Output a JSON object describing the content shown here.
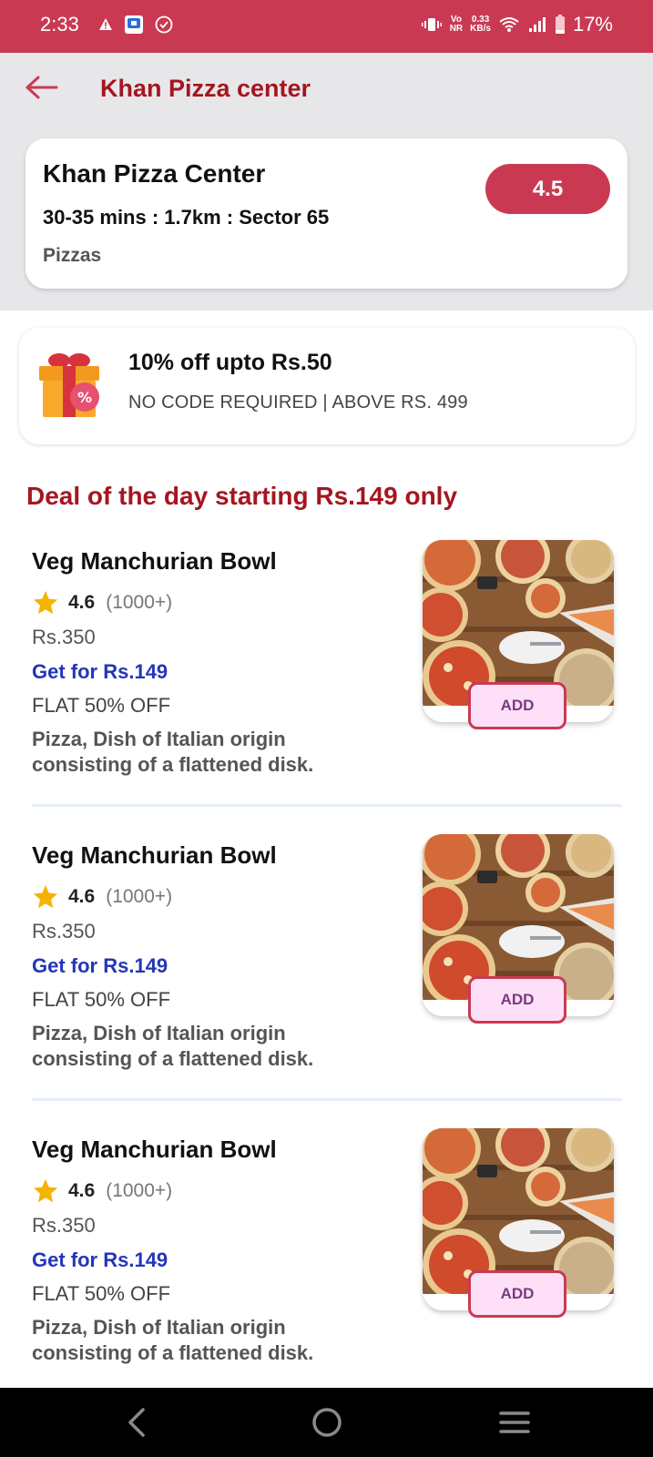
{
  "status_bar": {
    "time": "2:33",
    "network_speed_value": "0.33",
    "network_speed_unit": "KB/s",
    "volte_label": "Vo",
    "nr_label": "NR",
    "battery": "17%"
  },
  "header": {
    "title": "Khan Pizza center"
  },
  "restaurant": {
    "name": "Khan Pizza Center",
    "meta": "30-35 mins : 1.7km : Sector 65",
    "category": "Pizzas",
    "rating": "4.5"
  },
  "offer": {
    "title": "10% off upto Rs.50",
    "subtitle": "NO CODE REQUIRED | ABOVE RS. 499"
  },
  "section": {
    "title": "Deal of the day starting Rs.149 only"
  },
  "items": [
    {
      "name": "Veg Manchurian Bowl",
      "rating": "4.6",
      "rating_count": "(1000+)",
      "price": "Rs.350",
      "offer_price": "Get for Rs.149",
      "discount": "FLAT 50% OFF",
      "desc_line1": "Pizza, Dish of Italian origin",
      "desc_line2": "consisting of a flattened disk.",
      "add_label": "ADD"
    },
    {
      "name": "Veg Manchurian Bowl",
      "rating": "4.6",
      "rating_count": "(1000+)",
      "price": "Rs.350",
      "offer_price": "Get for Rs.149",
      "discount": "FLAT 50% OFF",
      "desc_line1": "Pizza, Dish of Italian origin",
      "desc_line2": "consisting of a flattened disk.",
      "add_label": "ADD"
    },
    {
      "name": "Veg Manchurian Bowl",
      "rating": "4.6",
      "rating_count": "(1000+)",
      "price": "Rs.350",
      "offer_price": "Get for Rs.149",
      "discount": "FLAT 50% OFF",
      "desc_line1": "Pizza, Dish of Italian origin",
      "desc_line2": "consisting of a flattened disk.",
      "add_label": "ADD"
    }
  ],
  "icons": {
    "back": "arrow-left-icon",
    "offer": "gift-box-icon",
    "star": "star-icon",
    "nav_back": "chevron-left-icon",
    "nav_home": "circle-home-icon",
    "nav_menu": "menu-lines-icon"
  },
  "colors": {
    "brand": "#c93a52",
    "title_red": "#a5161f",
    "offer_blue": "#2336b8",
    "star": "#f5b301",
    "add_bg": "#fde0f7"
  }
}
